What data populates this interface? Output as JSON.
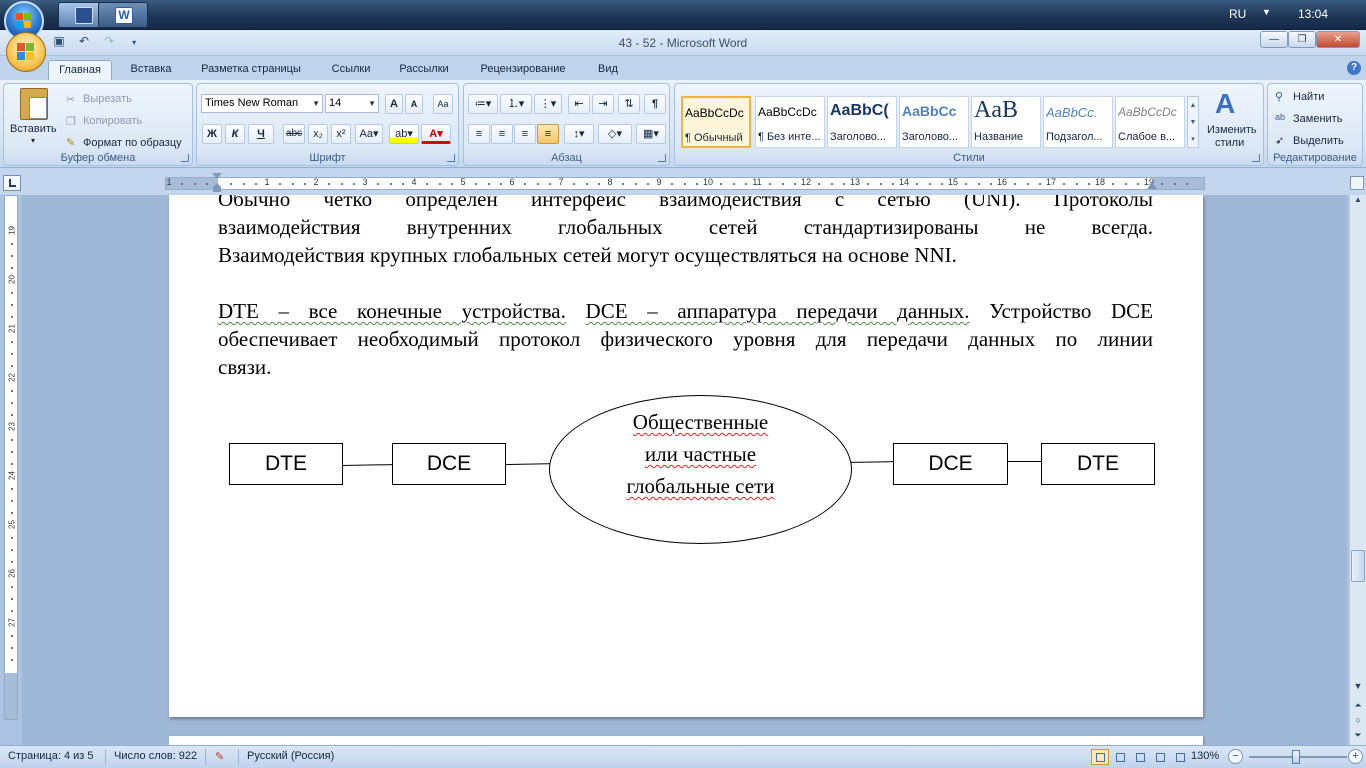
{
  "taskbar": {
    "language": "RU",
    "clock": "13:04"
  },
  "window": {
    "title": "43 - 52 - Microsoft Word"
  },
  "ribbon_tabs": [
    "Главная",
    "Вставка",
    "Разметка страницы",
    "Ссылки",
    "Рассылки",
    "Рецензирование",
    "Вид"
  ],
  "clipboard": {
    "paste": "Вставить",
    "cut": "Вырезать",
    "copy": "Копировать",
    "format_painter": "Формат по образцу",
    "label": "Буфер обмена"
  },
  "font": {
    "name": "Times New Roman",
    "size": "14",
    "bold": "Ж",
    "italic": "К",
    "underline": "Ч",
    "strike": "abc",
    "label": "Шрифт"
  },
  "paragraph": {
    "label": "Абзац"
  },
  "styles": {
    "items": [
      {
        "sample": "AaBbCcDc",
        "name": "¶ Обычный"
      },
      {
        "sample": "AaBbCcDc",
        "name": "¶ Без инте..."
      },
      {
        "sample": "AaBbC(",
        "name": "Заголово..."
      },
      {
        "sample": "AaBbCc",
        "name": "Заголово..."
      },
      {
        "sample": "AaB",
        "name": "Название"
      },
      {
        "sample": "AaBbCc.",
        "name": "Подзагол..."
      },
      {
        "sample": "AaBbCcDc",
        "name": "Слабое в..."
      }
    ],
    "change_styles_1": "Изменить",
    "change_styles_2": "стили",
    "label": "Стили"
  },
  "editing": {
    "find": "Найти",
    "replace": "Заменить",
    "select": "Выделить",
    "label": "Редактирование"
  },
  "document": {
    "para1": [
      "Обычно четко определен интерфейс взаимодействия с сетью (UNI). Протоколы",
      "взаимодействия внутренних глобальных сетей стандартизированы не всегда.",
      "Взаимодействия крупных глобальных сетей могут осуществляться на основе NNI."
    ],
    "para2": [
      "DTE – все конечные устройства. DCE – аппаратура передачи данных. Устройство DCE",
      "обеспечивает необходимый протокол физического уровня для передачи данных по линии",
      "связи."
    ],
    "diagram": {
      "left_dte": "DTE",
      "left_dce": "DCE",
      "cloud": [
        "Общественные",
        "или частные",
        "глобальные сети"
      ],
      "right_dce": "DCE",
      "right_dte": "DTE"
    }
  },
  "statusbar": {
    "page": "Страница: 4 из 5",
    "words": "Число слов: 922",
    "language": "Русский (Россия)",
    "zoom": "130%"
  }
}
